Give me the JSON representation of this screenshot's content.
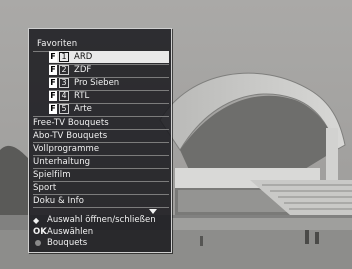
{
  "menu": {
    "header": "Favoriten",
    "favorites": [
      {
        "key": "F",
        "num": "1",
        "name": "ARD",
        "selected": true
      },
      {
        "key": "F",
        "num": "2",
        "name": "ZDF",
        "selected": false
      },
      {
        "key": "F",
        "num": "3",
        "name": "Pro Sieben",
        "selected": false
      },
      {
        "key": "F",
        "num": "4",
        "name": "RTL",
        "selected": false
      },
      {
        "key": "F",
        "num": "5",
        "name": "Arte",
        "selected": false
      }
    ],
    "categories": [
      "Free-TV Bouquets",
      "Abo-TV Bouquets",
      "Vollprogramme",
      "Unterhaltung",
      "Spielfilm",
      "Sport",
      "Doku & Info"
    ]
  },
  "help": {
    "toggle_icon": "◆",
    "toggle_text": "Auswahl öffnen/schließen",
    "ok_key": "OK",
    "ok_text": "Auswählen",
    "bouquets_icon": "grey-dot-button-icon",
    "bouquets_text": "Bouquets"
  },
  "colors": {
    "panel": "#16161a",
    "selection": "#e9e9e9",
    "text": "#f2f2f2"
  }
}
